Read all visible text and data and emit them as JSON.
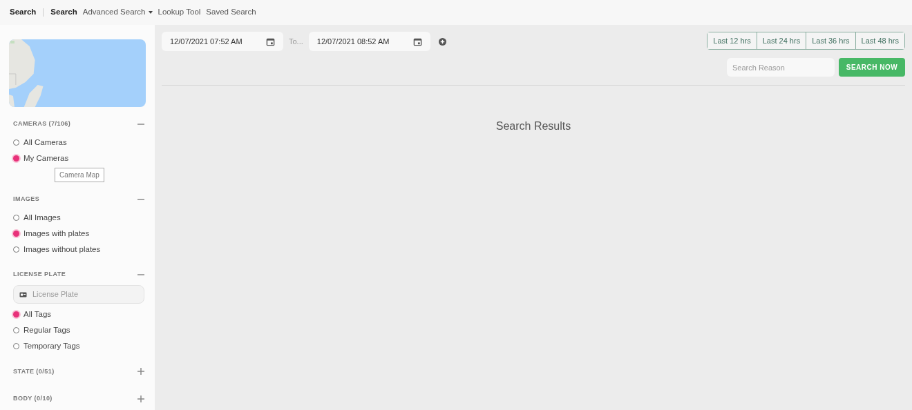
{
  "nav": {
    "title": "Search",
    "items": [
      {
        "label": "Search",
        "selected": true,
        "dropdown": false
      },
      {
        "label": "Advanced Search",
        "selected": false,
        "dropdown": true
      },
      {
        "label": "Lookup Tool",
        "selected": false,
        "dropdown": false
      },
      {
        "label": "Saved Search",
        "selected": false,
        "dropdown": false
      }
    ]
  },
  "sidebar": {
    "sections": [
      {
        "title": "CAMERAS (7/106)",
        "expanded": true,
        "items": [
          {
            "kind": "radio",
            "label": "All Cameras",
            "selected": false
          },
          {
            "kind": "radio",
            "label": "My Cameras",
            "selected": true
          },
          {
            "kind": "button",
            "label": "Camera Map"
          }
        ]
      },
      {
        "title": "IMAGES",
        "expanded": true,
        "items": [
          {
            "kind": "radio",
            "label": "All Images",
            "selected": false
          },
          {
            "kind": "radio",
            "label": "Images with plates",
            "selected": true
          },
          {
            "kind": "radio",
            "label": "Images without plates",
            "selected": false
          }
        ]
      },
      {
        "title": "LICENSE PLATE",
        "expanded": true,
        "items": [
          {
            "kind": "field",
            "placeholder": "License Plate"
          },
          {
            "kind": "radio",
            "label": "All Tags",
            "selected": true
          },
          {
            "kind": "radio",
            "label": "Regular Tags",
            "selected": false
          },
          {
            "kind": "radio",
            "label": "Temporary Tags",
            "selected": false
          }
        ]
      },
      {
        "title": "STATE (0/51)",
        "expanded": false
      },
      {
        "title": "BODY (0/10)",
        "expanded": false
      }
    ]
  },
  "date_range": {
    "from": "12/07/2021 07:52 AM",
    "separator": "To...",
    "to": "12/07/2021 08:52 AM"
  },
  "quick_ranges": [
    {
      "label": "Last 12 hrs",
      "selected": false
    },
    {
      "label": "Last 24 hrs",
      "selected": false
    },
    {
      "label": "Last 36 hrs",
      "selected": false
    },
    {
      "label": "Last 48 hrs",
      "selected": false
    }
  ],
  "search_reason": {
    "placeholder": "Search Reason"
  },
  "search_button": "SEARCH NOW",
  "results_title": "Search Results"
}
